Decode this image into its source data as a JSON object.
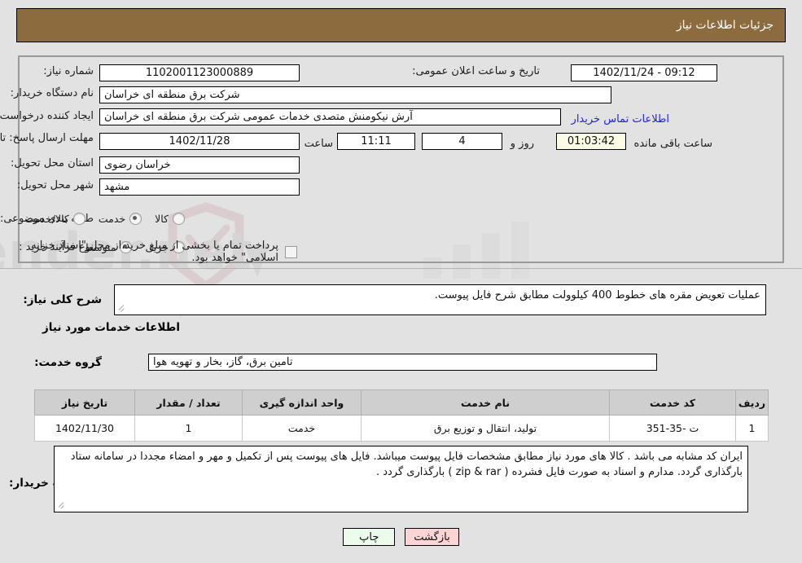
{
  "header": {
    "title": "جزئیات اطلاعات نیاز"
  },
  "form": {
    "need_number_label": "شماره نیاز:",
    "need_number_value": "1102001123000889",
    "announce_label": "تاریخ و ساعت اعلان عمومی:",
    "announce_value": "09:12 - 1402/11/24",
    "buyer_org_label": "نام دستگاه خریدار:",
    "buyer_org_value": "شرکت برق منطقه ای خراسان",
    "creator_label": "ایجاد کننده درخواست:",
    "creator_value": "آرش نیکومنش متصدی خدمات عمومی شرکت برق منطقه ای خراسان",
    "contact_link": "اطلاعات تماس خریدار",
    "deadline_label": "مهلت ارسال پاسخ: تا تاریخ:",
    "deadline_date": "1402/11/28",
    "hour_label": "ساعت",
    "hour_value": "11:11",
    "days_value": "4",
    "days_label": "روز و",
    "timer_value": "01:03:42",
    "remaining_label": "ساعت باقی مانده",
    "province_label": "استان محل تحویل:",
    "province_value": "خراسان رضوی",
    "city_label": "شهر محل تحویل:",
    "city_value": "مشهد",
    "category_label": "طبقه بندی موضوعی:",
    "category_options": [
      {
        "label": "کالا",
        "selected": false
      },
      {
        "label": "خدمت",
        "selected": true
      },
      {
        "label": "کالا/خدمت",
        "selected": false
      }
    ],
    "process_label": "نوع فرآیند خرید :",
    "process_options": [
      {
        "label": "جزیی",
        "selected": false
      },
      {
        "label": "متوسط",
        "selected": true
      }
    ],
    "treasury_checked": false,
    "treasury_note": "پرداخت تمام یا بخشی از مبلغ خرید،از محل \"اسناد خزانه اسلامی\" خواهد بود."
  },
  "details": {
    "general_desc_label": "شرح کلی نیاز:",
    "general_desc_value": "عملیات تعویض مقره های خطوط 400 کیلوولت مطابق شرح فایل پیوست.",
    "services_heading": "اطلاعات خدمات مورد نیاز",
    "service_group_label": "گروه خدمت:",
    "service_group_value": "تامین برق، گاز، بخار و تهویه هوا"
  },
  "table": {
    "headers": [
      "ردیف",
      "کد خدمت",
      "نام خدمت",
      "واحد اندازه گیری",
      "تعداد / مقدار",
      "تاریخ نیاز"
    ],
    "rows": [
      {
        "row": "1",
        "code": "ت -35-351",
        "name": "تولید، انتقال و توزیع برق",
        "unit": "خدمت",
        "qty": "1",
        "date": "1402/11/30"
      }
    ]
  },
  "notes": {
    "label": "توضیحات خریدار:",
    "value": "ایران کد مشابه می باشد . کالا های مورد نیاز مطابق مشخصات فایل پیوست میباشد. فایل های پیوست پس از تکمیل و مهر و امضاء مجددا در سامانه ستاد بارگذاری گردد. مدارم و اسناد به صورت فایل فشرده ( zip & rar ) بارگذاری گردد ."
  },
  "footer": {
    "print_label": "چاپ",
    "back_label": "بازگشت"
  },
  "colors": {
    "header_bg": "#8c6c3f",
    "link": "#2222dd",
    "timer_bg": "#fbfbe6",
    "print_bg": "#ecfbec",
    "back_bg": "#fbd5d5"
  }
}
